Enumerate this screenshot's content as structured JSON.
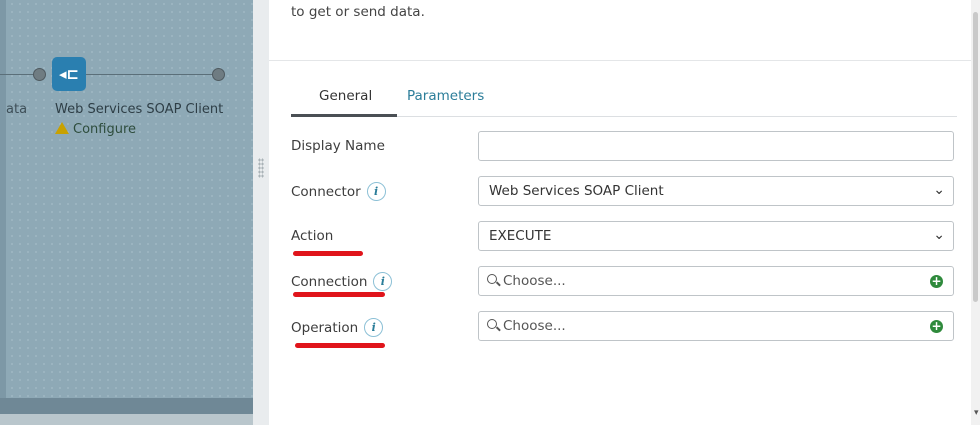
{
  "canvas": {
    "prev_step_label": "ata",
    "step_label": "Web Services SOAP Client",
    "configure_label": "Configure",
    "step_icon_glyph": "◂⊏",
    "background": "#8ea9b6",
    "step_color": "#2a7fb0"
  },
  "panel": {
    "description": "to get or send data.",
    "tabs": [
      {
        "label": "General",
        "active": true
      },
      {
        "label": "Parameters",
        "active": false
      }
    ],
    "fields": {
      "display_name": {
        "label": "Display Name",
        "value": ""
      },
      "connector": {
        "label": "Connector",
        "value": "Web Services SOAP Client"
      },
      "action": {
        "label": "Action",
        "value": "EXECUTE"
      },
      "connection": {
        "label": "Connection",
        "placeholder": "Choose..."
      },
      "operation": {
        "label": "Operation",
        "placeholder": "Choose..."
      }
    },
    "info_glyph": "i",
    "chevron": "⌄",
    "plus_glyph": "+",
    "accent_color": "#2b7d99",
    "add_color": "#2f8a3c",
    "annotation_color": "#e0141b"
  }
}
